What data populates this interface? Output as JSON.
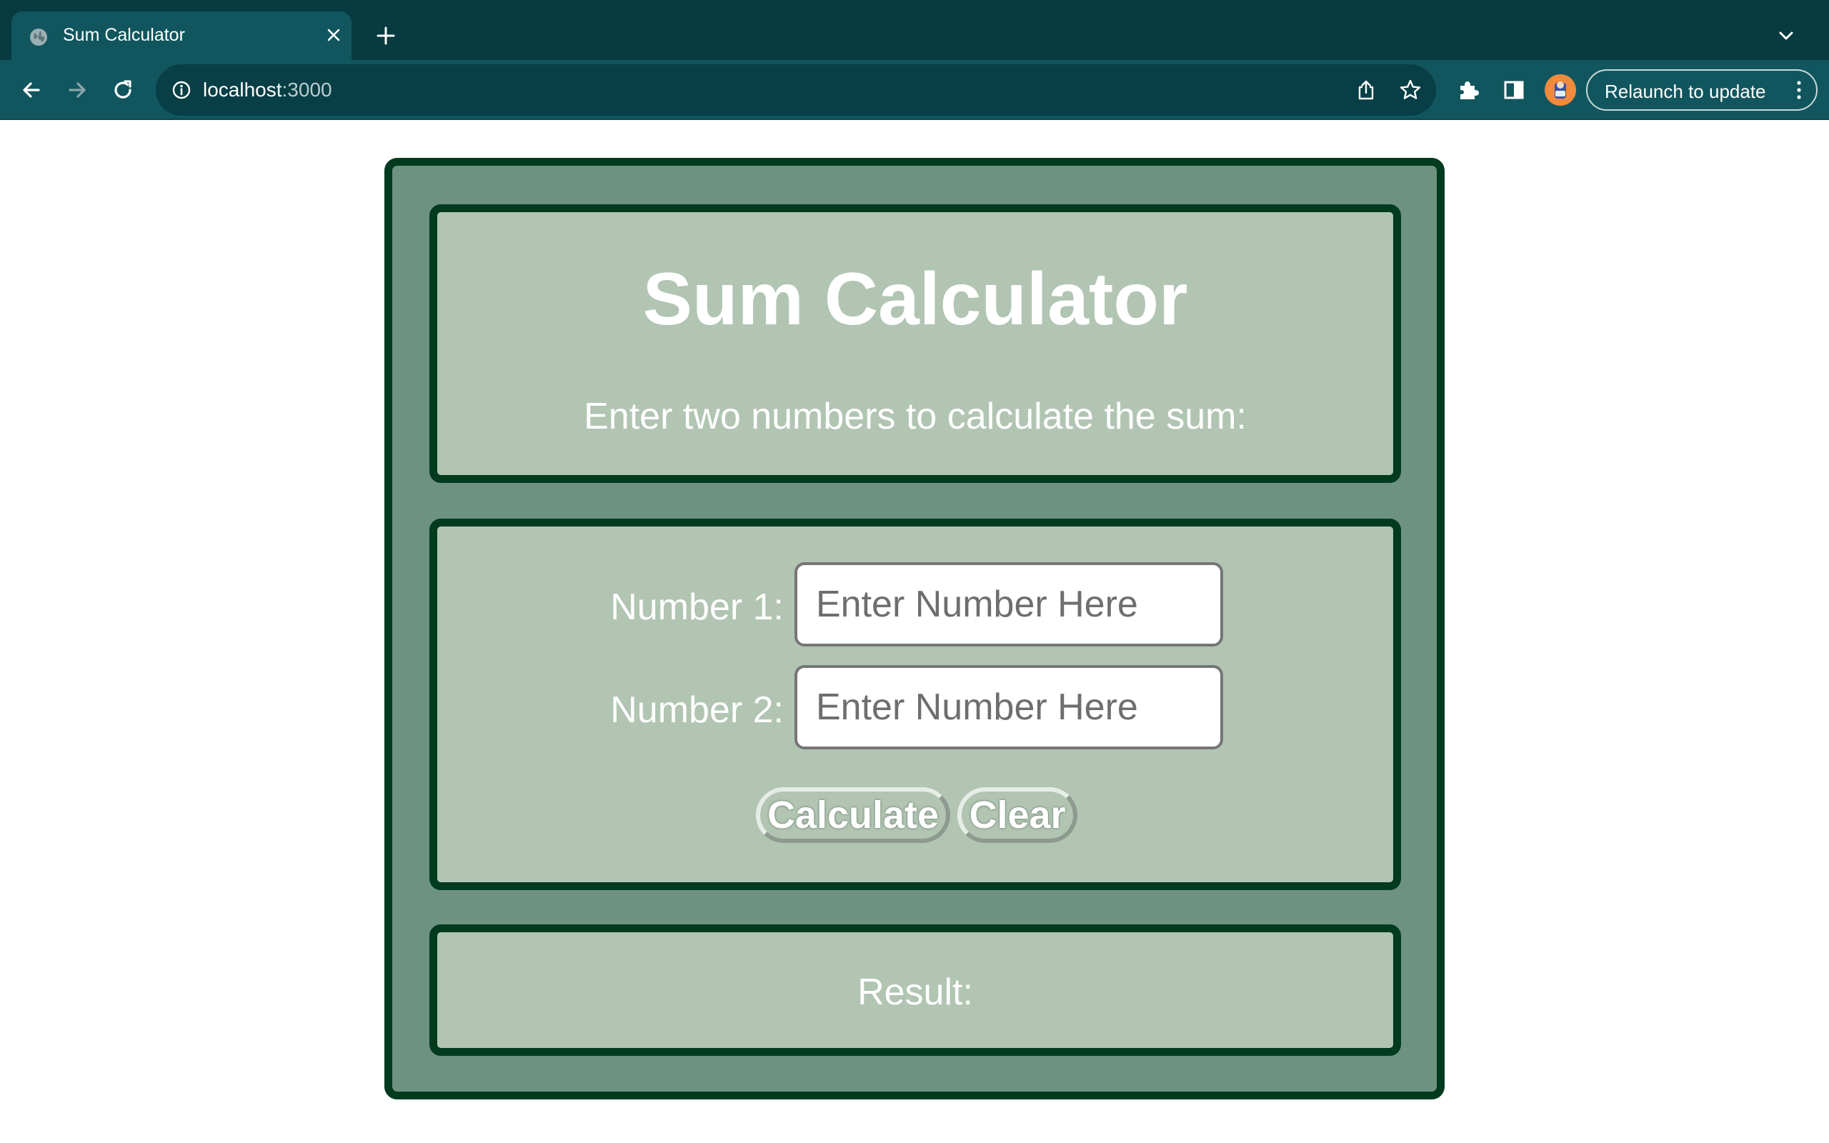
{
  "browser": {
    "tab": {
      "title": "Sum Calculator"
    },
    "address_bar": {
      "host": "localhost",
      "port": ":3000"
    },
    "relaunch_button": {
      "label": "Relaunch to update"
    }
  },
  "page": {
    "title": "Sum Calculator",
    "subtitle": "Enter two numbers to calculate the sum:",
    "form": {
      "number1": {
        "label": "Number 1:",
        "placeholder": "Enter Number Here",
        "value": ""
      },
      "number2": {
        "label": "Number 2:",
        "placeholder": "Enter Number Here",
        "value": ""
      },
      "calculate_label": "Calculate",
      "clear_label": "Clear"
    },
    "result": {
      "label": "Result:"
    }
  },
  "colors": {
    "tabstrip": "#073a41",
    "toolbar": "#11565e",
    "outer_card": "#6d9282",
    "inner_panel": "#b1c5b2",
    "border": "#003a1f"
  },
  "icons": [
    "globe-icon",
    "close-icon",
    "plus-icon",
    "chevron-down-icon",
    "back-arrow-icon",
    "forward-arrow-icon",
    "reload-icon",
    "info-icon",
    "share-icon",
    "star-icon",
    "puzzle-icon",
    "side-panel-icon",
    "kebab-menu-icon"
  ]
}
